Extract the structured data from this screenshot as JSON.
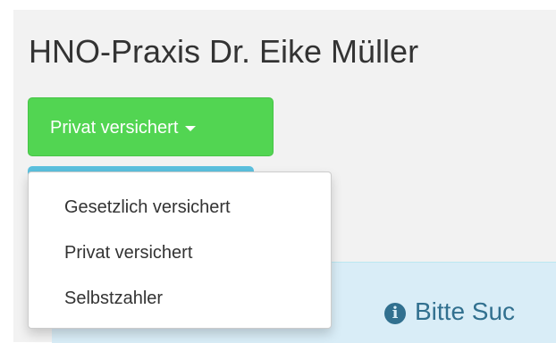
{
  "header": {
    "title": "HNO-Praxis Dr. Eike Müller"
  },
  "insurance_dropdown": {
    "selected_label": "Privat versichert",
    "options": [
      "Gesetzlich versichert",
      "Privat versichert",
      "Selbstzahler"
    ]
  },
  "info_alert": {
    "icon": "info-circle-icon",
    "text": "Bitte Suc"
  },
  "colors": {
    "button_green": "#52d552",
    "info_blue": "#5bc0de",
    "alert_background": "#d9edf7",
    "alert_text": "#31708f"
  }
}
